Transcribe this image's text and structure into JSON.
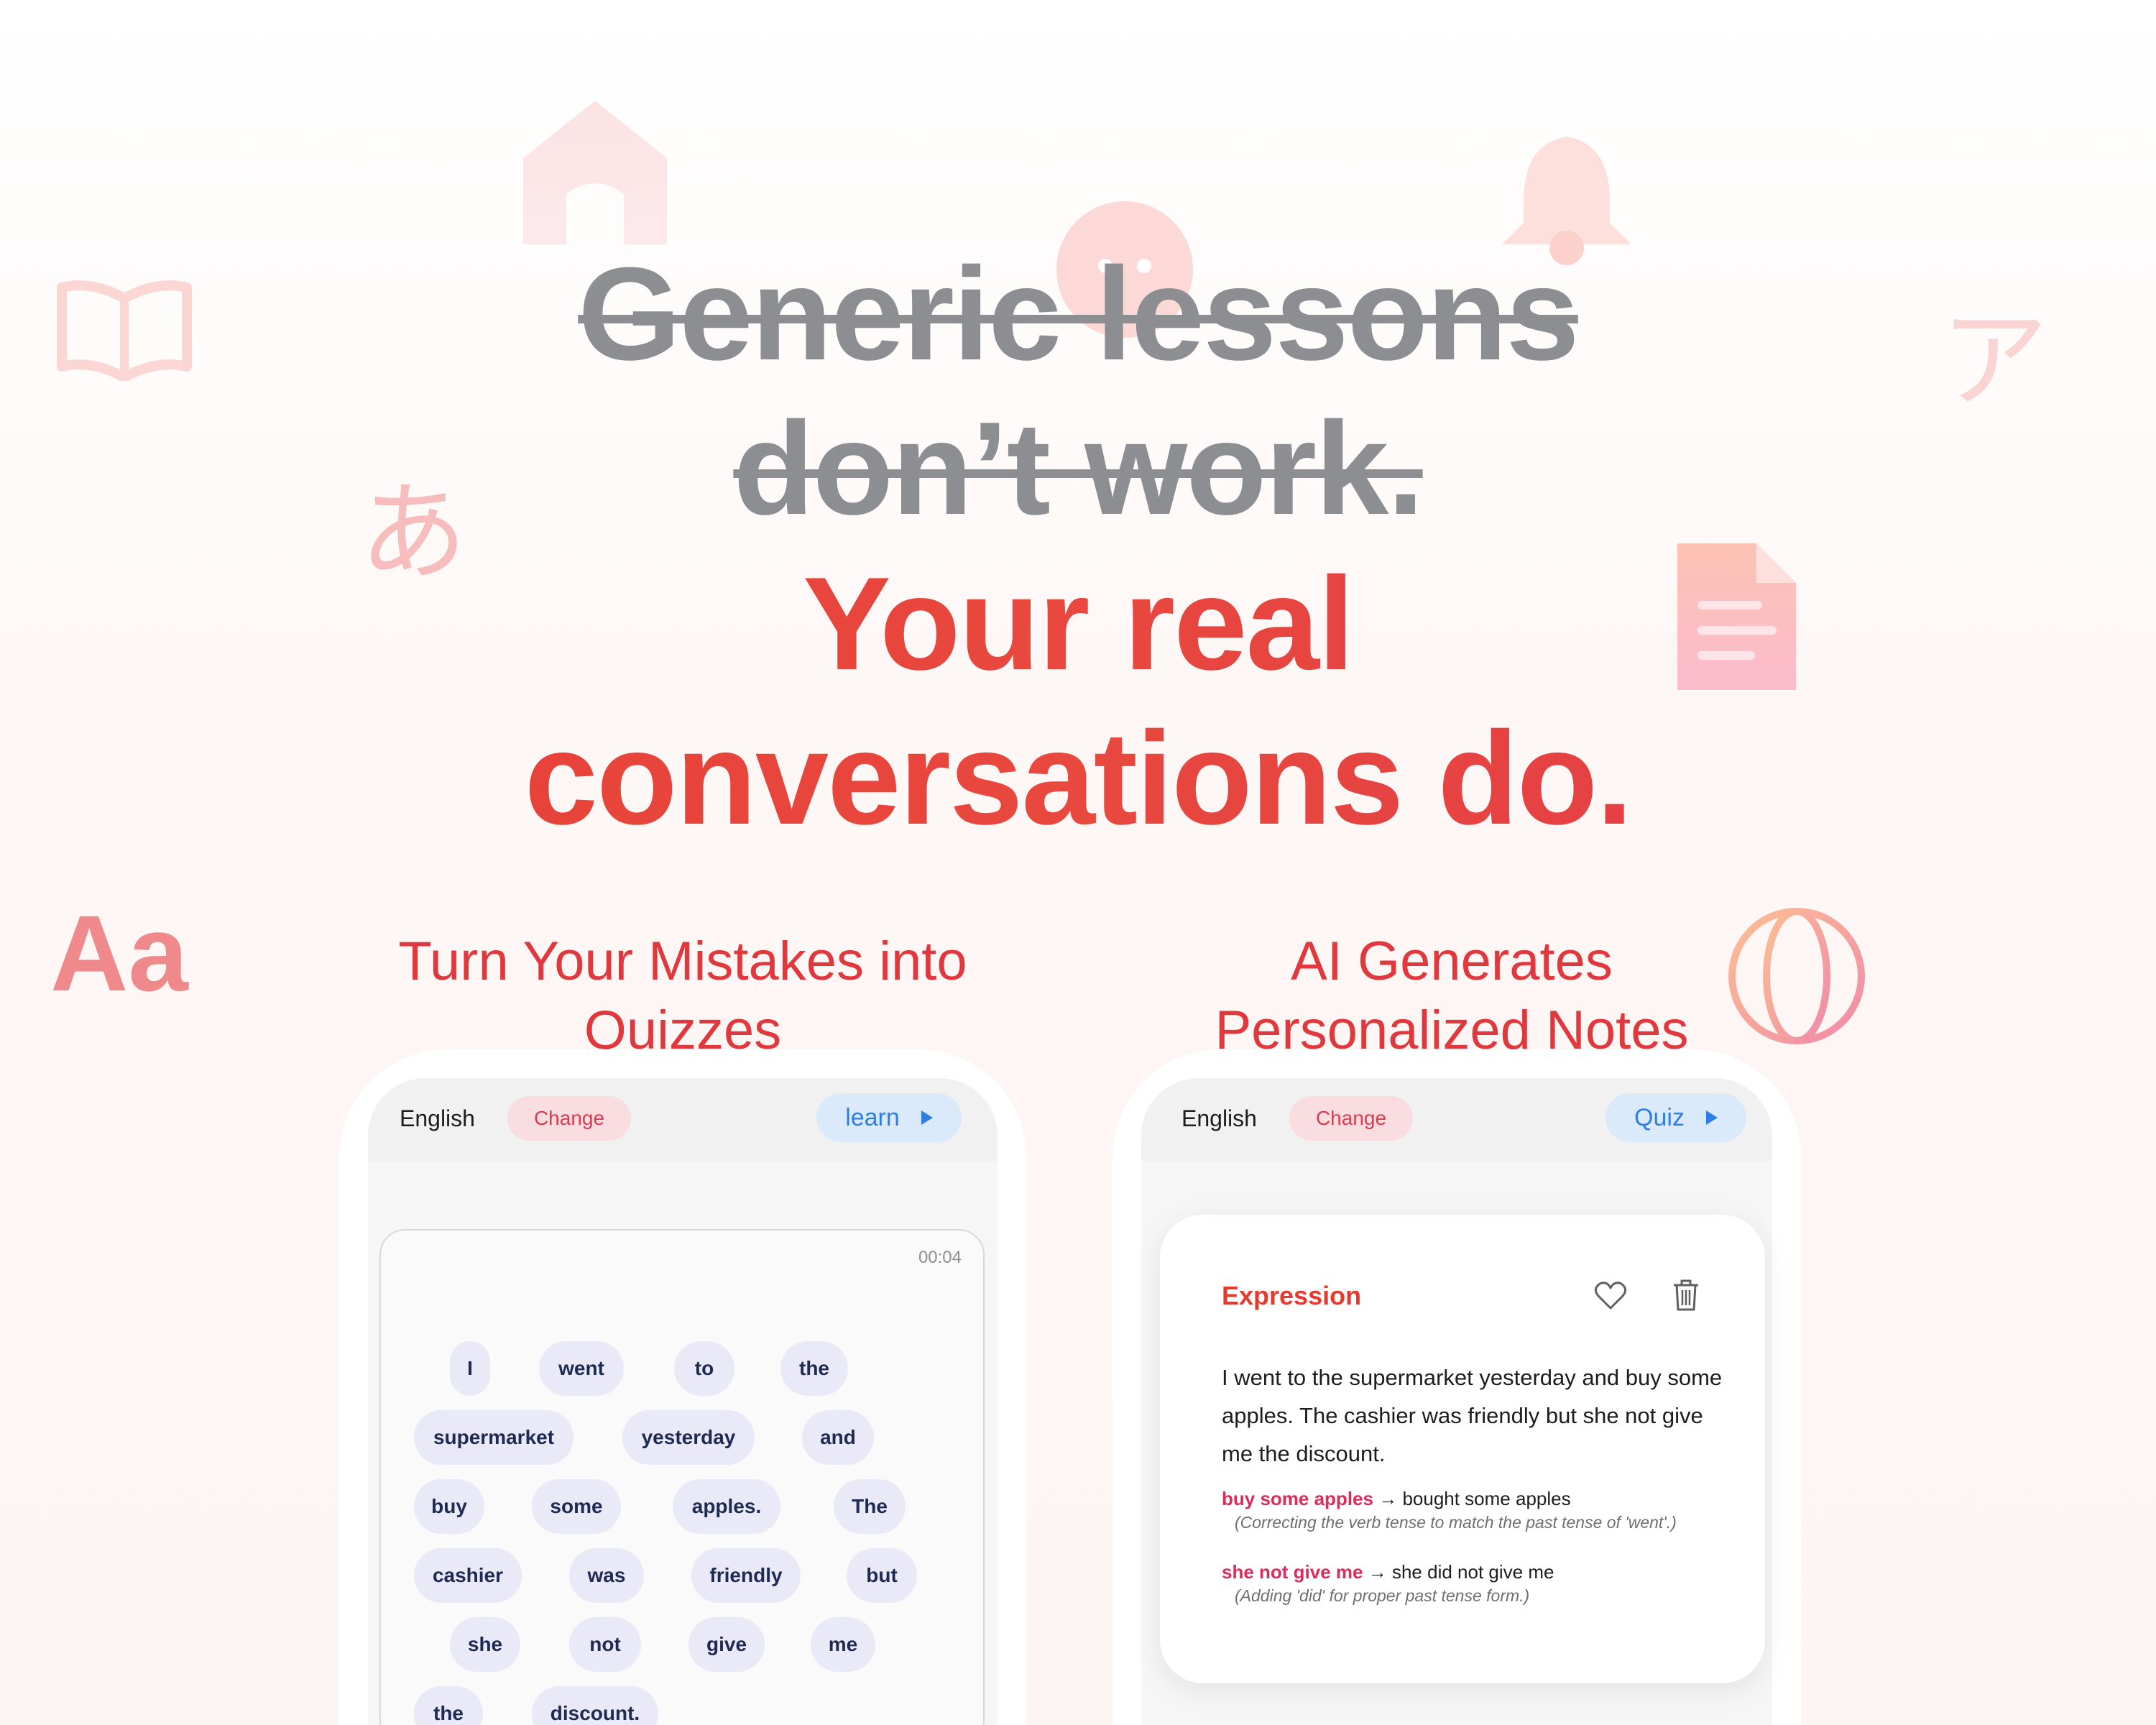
{
  "headline": {
    "struck_line1": "Generic lessons",
    "struck_line2": "don’t work.",
    "real_line1": "Your real",
    "real_line2": "conversations do."
  },
  "decor": {
    "hiragana": "あ",
    "katakana": "ア",
    "latin": "Aa",
    "icons": [
      "house-icon",
      "face-icon",
      "bell-icon",
      "open-book-icon",
      "document-icon",
      "globe-icon"
    ]
  },
  "features": {
    "left_title": "Turn Your Mistakes into Quizzes",
    "right_title": "AI Generates Personalized Notes"
  },
  "left_phone": {
    "language": "English",
    "change_label": "Change",
    "action_label": "learn",
    "timer": "00:04",
    "words": [
      "I",
      "went",
      "to",
      "the",
      "supermarket",
      "yesterday",
      "and",
      "buy",
      "some",
      "apples.",
      "The",
      "cashier",
      "was",
      "friendly",
      "but",
      "she",
      "not",
      "give",
      "me",
      "the",
      "discount."
    ]
  },
  "right_phone": {
    "language": "English",
    "change_label": "Change",
    "action_label": "Quiz",
    "card": {
      "label": "Expression",
      "text": "I went to the supermarket yesterday and buy some apples. The cashier was friendly but she not give me the discount.",
      "corrections": [
        {
          "wrong": "buy some apples",
          "right": "bought some apples",
          "note": "(Correcting the verb tense to match the past tense of 'went'.)"
        },
        {
          "wrong": "she not give me",
          "right": "she did not give me",
          "note": "(Adding 'did' for proper past tense form.)"
        }
      ]
    }
  },
  "colors": {
    "accent_red": "#e63e36",
    "strike_gray": "#8d8e92",
    "link_blue": "#2f7ee3",
    "chip_bg": "#e9e9f7"
  }
}
